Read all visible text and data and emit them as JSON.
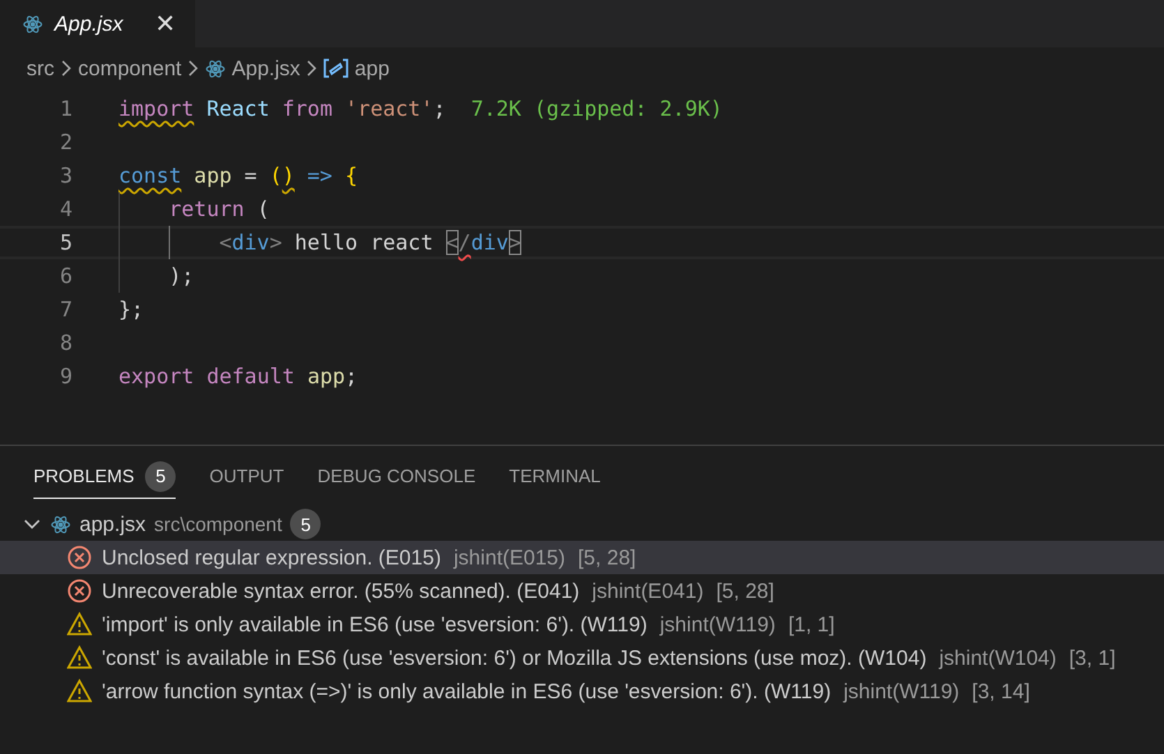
{
  "editor_tabs": [
    {
      "label": "App.jsx",
      "selected": true,
      "preview": true,
      "close": "✕"
    }
  ],
  "breadcrumb": [
    {
      "label": "src",
      "kind": "folder"
    },
    {
      "label": "component",
      "kind": "folder"
    },
    {
      "label": "App.jsx",
      "kind": "file"
    },
    {
      "label": "app",
      "kind": "symbol"
    }
  ],
  "code_lines": [
    {
      "number": "1",
      "current": false,
      "tokens": [
        {
          "text": "import",
          "kind": "control",
          "warning_squiggle": true
        },
        {
          "text": "React",
          "kind": "variable",
          "space_before": true
        },
        {
          "text": "from",
          "kind": "control",
          "space_before": true
        },
        {
          "text": "'react'",
          "kind": "string",
          "space_before": true
        },
        {
          "text": ";",
          "kind": "text"
        },
        {
          "text": "7.2K (gzipped: 2.9K)",
          "kind": "hint"
        }
      ]
    },
    {
      "number": "2",
      "current": false
    },
    {
      "number": "3",
      "current": false,
      "tokens": [
        {
          "text": "const",
          "kind": "keyword",
          "warning_squiggle": true
        },
        {
          "text": "app",
          "kind": "function",
          "space_before": true
        },
        {
          "text": "=",
          "kind": "text",
          "space_before": true
        },
        {
          "text": "(",
          "kind": "bracket",
          "space_before": true
        },
        {
          "text": ")",
          "kind": "bracket",
          "warning_squiggle": true
        },
        {
          "text": "=>",
          "kind": "keyword",
          "space_before": true
        },
        {
          "text": "{",
          "kind": "bracket",
          "space_before": true
        }
      ]
    },
    {
      "number": "4",
      "current": false,
      "indent_guides": [
        {
          "active": false
        }
      ],
      "tokens": [
        {
          "text": "return",
          "kind": "control"
        },
        {
          "text": "(",
          "kind": "text",
          "space_before": true
        }
      ]
    },
    {
      "number": "5",
      "current": true,
      "indent_guides": [
        {
          "active": false
        },
        {
          "active": true
        }
      ],
      "tokens": [
        {
          "text": "<",
          "kind": "punct"
        },
        {
          "text": "div",
          "kind": "tag"
        },
        {
          "text": ">",
          "kind": "punct"
        },
        {
          "text": "hello react",
          "kind": "text",
          "space_before": true
        },
        {
          "text": "<",
          "kind": "punct",
          "bracket_match": true,
          "space_before": true
        },
        {
          "text": "/",
          "kind": "punct",
          "error_squiggle": true
        },
        {
          "text": "div",
          "kind": "tag"
        },
        {
          "text": ">",
          "kind": "punct",
          "bracket_match": true
        }
      ]
    },
    {
      "number": "6",
      "current": false,
      "indent_guides": [
        {
          "active": false
        }
      ],
      "tokens": [
        {
          "text": ");",
          "kind": "text"
        }
      ]
    },
    {
      "number": "7",
      "current": false,
      "tokens": [
        {
          "text": "};",
          "kind": "text"
        }
      ]
    },
    {
      "number": "8",
      "current": false
    },
    {
      "number": "9",
      "current": false,
      "tokens": [
        {
          "text": "export",
          "kind": "control"
        },
        {
          "text": "default",
          "kind": "control",
          "space_before": true
        },
        {
          "text": "app",
          "kind": "function",
          "space_before": true
        },
        {
          "text": ";",
          "kind": "text"
        }
      ]
    }
  ],
  "panel_tabs": [
    {
      "label": "PROBLEMS",
      "badge": "5",
      "selected": true
    },
    {
      "label": "OUTPUT",
      "selected": false
    },
    {
      "label": "DEBUG CONSOLE",
      "selected": false
    },
    {
      "label": "TERMINAL",
      "selected": false
    }
  ],
  "problems": {
    "file": {
      "name": "app.jsx",
      "path": "src\\component",
      "count": "5",
      "expanded": true
    },
    "items": [
      {
        "kind": "error",
        "message": "Unclosed regular expression. (E015)",
        "source": "jshint(E015)",
        "position": "[5, 28]",
        "selected": true
      },
      {
        "kind": "error",
        "message": "Unrecoverable syntax error. (55% scanned). (E041)",
        "source": "jshint(E041)",
        "position": "[5, 28]",
        "selected": false
      },
      {
        "kind": "warning",
        "message": "'import' is only available in ES6 (use 'esversion: 6'). (W119)",
        "source": "jshint(W119)",
        "position": "[1, 1]",
        "selected": false
      },
      {
        "kind": "warning",
        "message": "'const' is available in ES6 (use 'esversion: 6') or Mozilla JS extensions (use moz). (W104)",
        "source": "jshint(W104)",
        "position": "[3, 1]",
        "selected": false
      },
      {
        "kind": "warning",
        "message": "'arrow function syntax (=>)' is only available in ES6 (use 'esversion: 6'). (W119)",
        "source": "jshint(W119)",
        "position": "[3, 14]",
        "selected": false
      }
    ]
  }
}
